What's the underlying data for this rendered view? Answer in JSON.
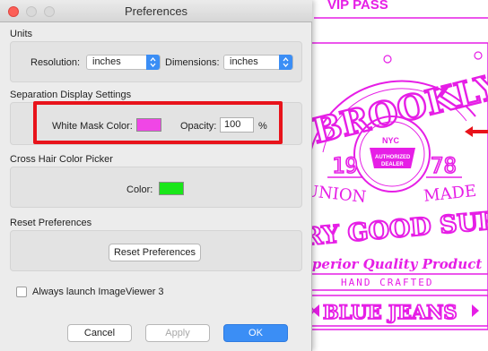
{
  "window": {
    "title": "Preferences"
  },
  "units": {
    "heading": "Units",
    "resolution_label": "Resolution:",
    "resolution_value": "inches",
    "dimensions_label": "Dimensions:",
    "dimensions_value": "inches"
  },
  "separation": {
    "heading": "Separation Display Settings",
    "white_mask_label": "White Mask Color:",
    "white_mask_color": "#f046e6",
    "opacity_label": "Opacity:",
    "opacity_value": "100",
    "opacity_unit": "%"
  },
  "crosshair": {
    "heading": "Cross Hair Color Picker",
    "color_label": "Color:",
    "color_value": "#19e619"
  },
  "reset": {
    "heading": "Reset Preferences",
    "button_label": "Reset Preferences"
  },
  "launch": {
    "checkbox_label": "Always launch ImageViewer 3",
    "checked": false
  },
  "footer": {
    "cancel_label": "Cancel",
    "apply_label": "Apply",
    "ok_label": "OK"
  },
  "artwork": {
    "top_text": "VIP PASS",
    "brooklyn": "BROOKLYN",
    "nyc": "NYC",
    "badge_line1": "AUTHORIZED",
    "badge_line2": "DEALER",
    "year_left": "19",
    "year_right": "78",
    "union": "UNION",
    "made": "MADE",
    "good_supply": "RY GOOD SUPPLY",
    "quality": "uperior Quality Product",
    "hand_crafted": "HAND CRAFTED",
    "blue_jeans": "BLUE JEANS",
    "ink_color": "#e61ee6"
  },
  "colors": {
    "highlight": "#e8131b",
    "accent": "#3b8ef5"
  }
}
